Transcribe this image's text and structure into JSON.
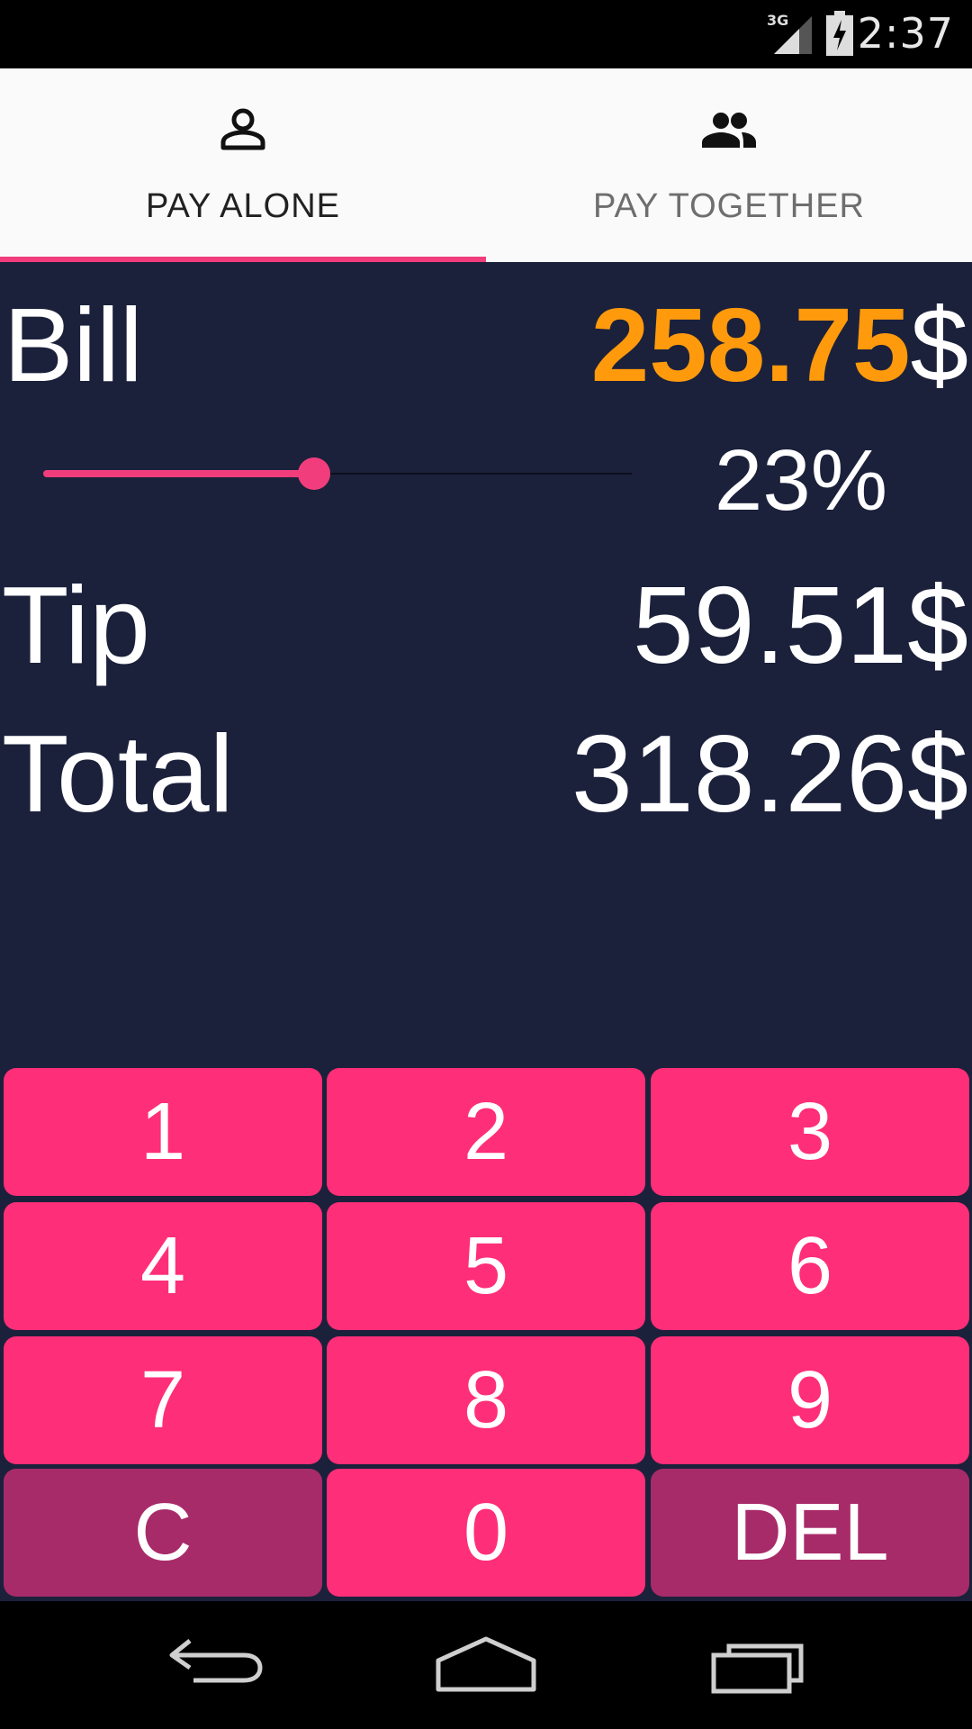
{
  "status_bar": {
    "network": "3G",
    "time": "2:37"
  },
  "tabs": [
    {
      "label": "PAY ALONE",
      "icon": "person-icon",
      "selected": true
    },
    {
      "label": "PAY TOGETHER",
      "icon": "people-icon",
      "selected": false
    }
  ],
  "bill": {
    "label": "Bill",
    "amount": "258.75",
    "currency": "$"
  },
  "tip_slider": {
    "percent": 23,
    "percent_label": "23%"
  },
  "tip": {
    "label": "Tip",
    "value": "59.51$"
  },
  "total": {
    "label": "Total",
    "value": "318.26$"
  },
  "keypad": {
    "keys": [
      "1",
      "2",
      "3",
      "4",
      "5",
      "6",
      "7",
      "8",
      "9",
      "C",
      "0",
      "DEL"
    ]
  },
  "navbar": {
    "icons": [
      "back-icon",
      "home-icon",
      "recents-icon"
    ]
  },
  "colors": {
    "accent": "#f23d7d",
    "key": "#ff2e78",
    "key_alt": "#a82b69",
    "bill_amount": "#ff9a0d",
    "panel": "#1b213b"
  }
}
